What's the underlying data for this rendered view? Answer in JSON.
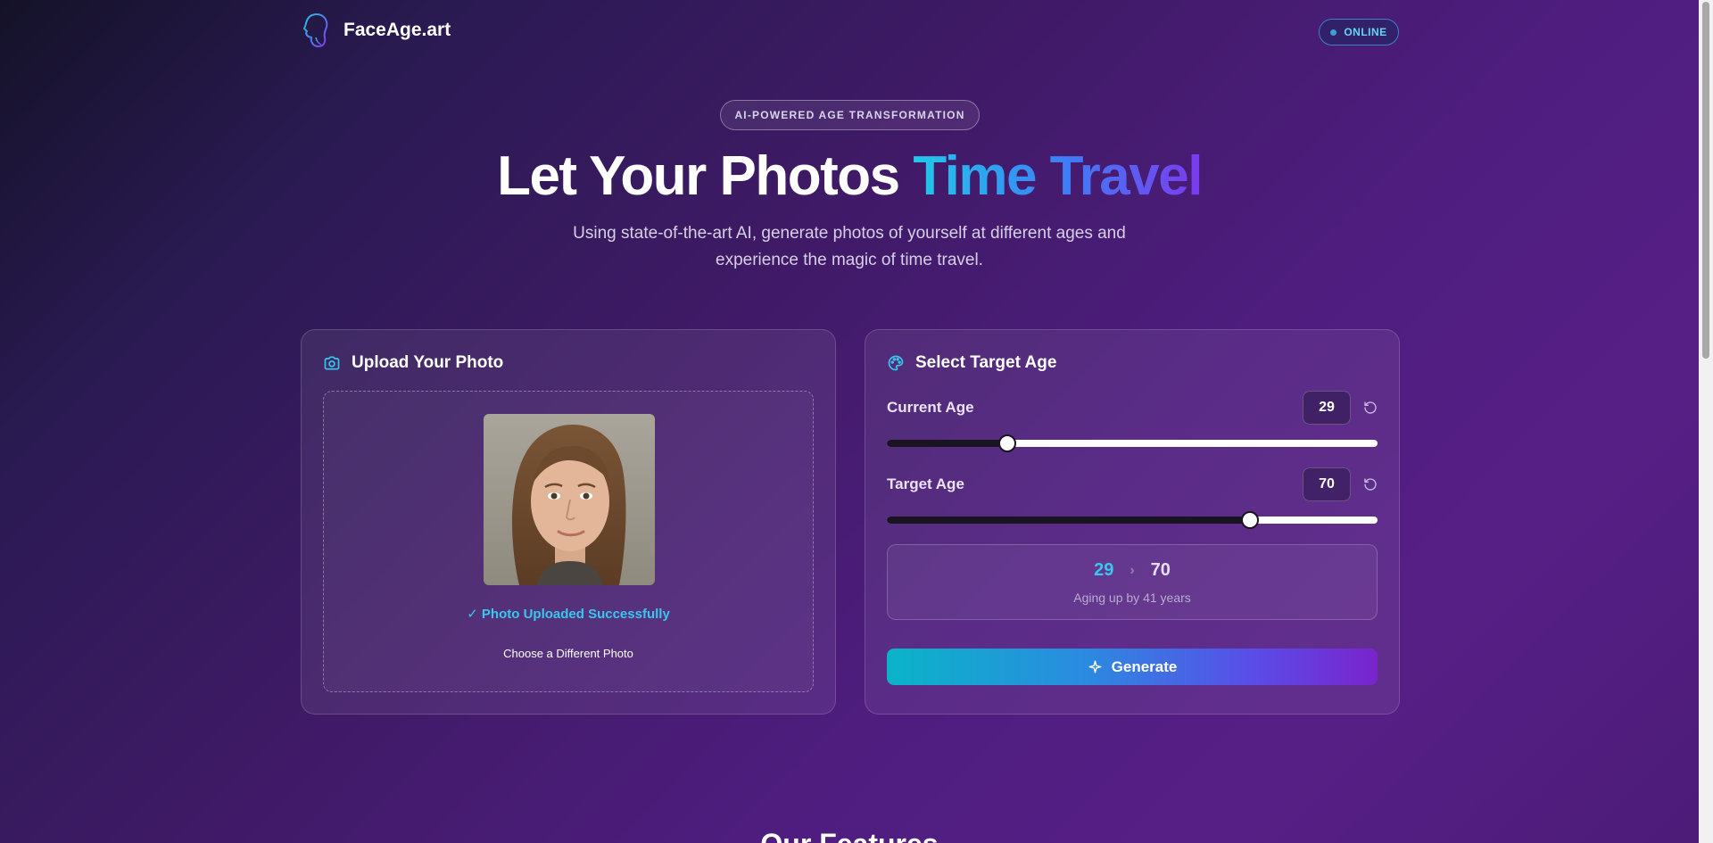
{
  "header": {
    "brand": "FaceAge.art",
    "status": "ONLINE"
  },
  "hero": {
    "badge": "AI-POWERED AGE TRANSFORMATION",
    "title_plain": "Let Your Photos ",
    "title_highlight": "Time Travel",
    "subtitle": "Using state-of-the-art AI, generate photos of yourself at different ages and experience the magic of time travel."
  },
  "upload": {
    "title": "Upload Your Photo",
    "success": "✓ Photo Uploaded Successfully",
    "change_label": "Choose a Different Photo"
  },
  "age": {
    "title": "Select Target Age",
    "current_label": "Current Age",
    "current_value": "29",
    "current_slider_fraction": 0.245,
    "target_label": "Target Age",
    "target_value": "70",
    "target_slider_fraction": 0.74,
    "summary_from": "29",
    "summary_to": "70",
    "summary_text": "Aging up by 41 years",
    "generate_label": "Generate"
  },
  "features": {
    "title": "Our Features"
  },
  "colors": {
    "accent_cyan": "#38c8ee",
    "accent_purple": "#7c3aed"
  }
}
